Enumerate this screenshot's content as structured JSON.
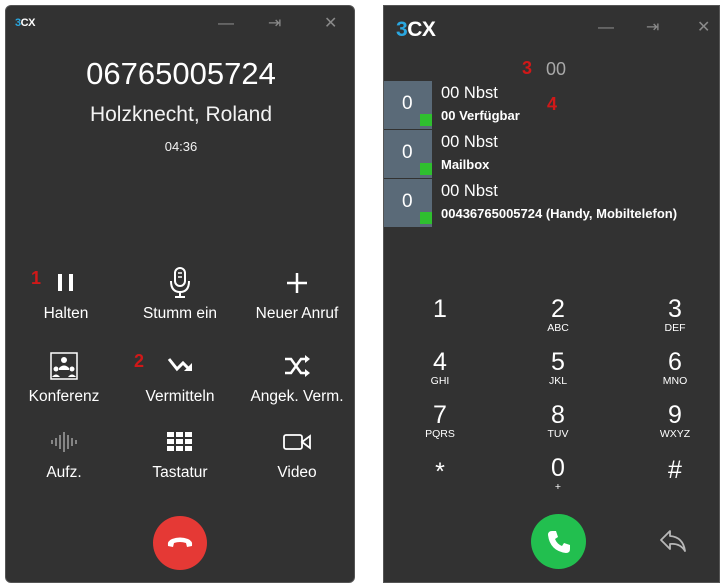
{
  "left": {
    "logo": {
      "three": "3",
      "cx": "CX"
    },
    "window_controls": [
      "—",
      "⇥",
      "✕"
    ],
    "phone_number": "06765005724",
    "caller_name": "Holzknecht, Roland",
    "duration": "04:36",
    "controls": [
      {
        "label": "Halten",
        "icon": "pause-icon"
      },
      {
        "label": "Stumm ein",
        "icon": "microphone-icon"
      },
      {
        "label": "Neuer Anruf",
        "icon": "plus-icon"
      },
      {
        "label": "Konferenz",
        "icon": "conference-icon"
      },
      {
        "label": "Vermitteln",
        "icon": "transfer-icon"
      },
      {
        "label": "Angek. Verm.",
        "icon": "shuffle-icon"
      },
      {
        "label": "Aufz.",
        "icon": "waveform-icon"
      },
      {
        "label": "Tastatur",
        "icon": "keypad-icon"
      },
      {
        "label": "Video",
        "icon": "video-camera-icon"
      }
    ],
    "markers": {
      "m1": "1",
      "m2": "2"
    },
    "hangup_color": "#e53935"
  },
  "right": {
    "logo": {
      "three": "3",
      "cx": "CX"
    },
    "window_controls": [
      "—",
      "⇥",
      "✕"
    ],
    "markers": {
      "m3": "3",
      "m4": "4"
    },
    "extension_input": "00",
    "blf": [
      {
        "count": "0",
        "name": "00 Nbst",
        "status": "00 Verfügbar"
      },
      {
        "count": "0",
        "name": "00 Nbst",
        "status": "Mailbox"
      },
      {
        "count": "0",
        "name": "00 Nbst",
        "status": "00436765005724 (Handy, Mobiltelefon)"
      }
    ],
    "keypad": [
      {
        "digit": "1",
        "letters": ""
      },
      {
        "digit": "2",
        "letters": "ABC"
      },
      {
        "digit": "3",
        "letters": "DEF"
      },
      {
        "digit": "4",
        "letters": "GHI"
      },
      {
        "digit": "5",
        "letters": "JKL"
      },
      {
        "digit": "6",
        "letters": "MNO"
      },
      {
        "digit": "7",
        "letters": "PQRS"
      },
      {
        "digit": "8",
        "letters": "TUV"
      },
      {
        "digit": "9",
        "letters": "WXYZ"
      },
      {
        "digit": "*",
        "letters": ""
      },
      {
        "digit": "0",
        "letters": "+"
      },
      {
        "digit": "#",
        "letters": ""
      }
    ],
    "call_color": "#22bf4f",
    "blf_led_color": "#2fbf2f"
  }
}
